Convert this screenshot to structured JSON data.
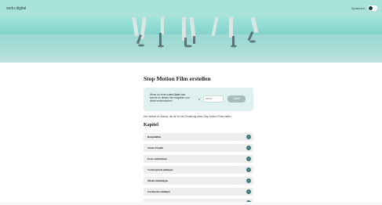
{
  "topbar": {
    "logo": "sedu.digital",
    "language": "Sprachen"
  },
  "page": {
    "title": "Stop Motion Film erstellen",
    "code_box": {
      "text_before": "Wenn du einen ",
      "text_strong": "Lern-Code",
      "text_after": " hast, kannst du diesen hier eingeben und direkt weitermachen.",
      "prefix": "#",
      "input_placeholder": "ABCD",
      "button": "Laden"
    },
    "intro": "Hier findest du Videos, die dir bei der Erstellung eines Stop Motion Films helfen.",
    "chapters_heading": "Kapitel",
    "chapters": [
      {
        "label": "Beispielfilm"
      },
      {
        "label": "Neues Projekt"
      },
      {
        "label": "Fotos aufnehmen"
      },
      {
        "label": "Vordergrund einfügen"
      },
      {
        "label": "Musik hinzufügen"
      },
      {
        "label": "Geräusche einfügen"
      },
      {
        "label": "Stimme einfügen"
      }
    ]
  },
  "icons": {
    "chapter_action": "play-circle-icon"
  },
  "colors": {
    "topbar": "#a9e3da",
    "code_box": "#dff1ef",
    "chapter_bg": "#eeeeee",
    "chapter_icon": "#3f7a73",
    "button": "#a7bdbb"
  }
}
